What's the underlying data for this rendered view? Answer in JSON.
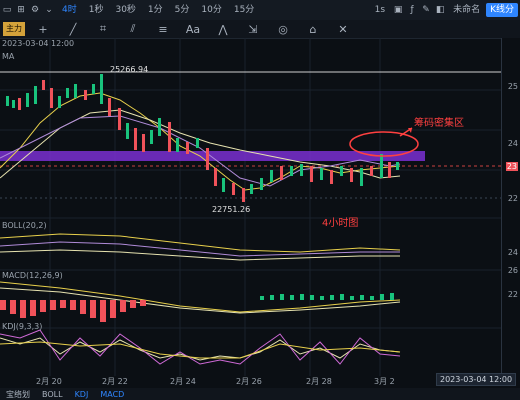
{
  "topbar": {
    "items": [
      "4时",
      "1秒",
      "30秒",
      "1分",
      "5分",
      "10分",
      "15分",
      "1s",
      "未命名"
    ],
    "kline_label": "K线分"
  },
  "toolbar": {
    "left_badge": "主力",
    "date": "2023-03-04 12:00",
    "ma_label": "MA"
  },
  "price_labels": {
    "high": "25266.94",
    "low": "22751.26"
  },
  "annotations": {
    "chip_zone": "筹码密集区",
    "timeframe": "4小时图"
  },
  "indicators": {
    "boll": "BOLL(20,2)",
    "macd": "MACD(12,26,9)",
    "kdj": "KDJ(9,3,3)"
  },
  "right_axis": [
    "25",
    "24",
    "23",
    "22",
    "24",
    "26",
    "22"
  ],
  "x_axis": [
    "2月 20",
    "2月 22",
    "2月 24",
    "2月 26",
    "2月 28",
    "3月 2"
  ],
  "date_box": "2023-03-04 12:00",
  "bottombar": {
    "items": [
      "宝络划",
      "BOLL",
      "KDJ",
      "MACD"
    ]
  },
  "colors": {
    "up": "#19c37d",
    "down": "#f0525a",
    "accent": "#2f86ff",
    "band": "#7a2fd1",
    "annotation": "#ff4040"
  }
}
